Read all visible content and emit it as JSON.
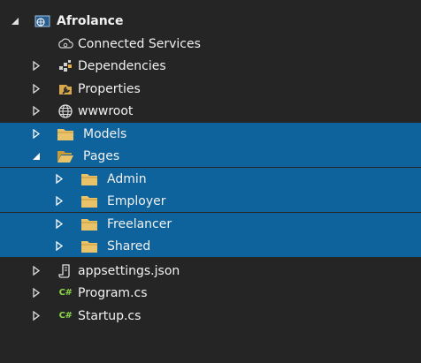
{
  "tree": {
    "project": "Afrolance",
    "items": [
      {
        "label": "Connected Services"
      },
      {
        "label": "Dependencies"
      },
      {
        "label": "Properties"
      },
      {
        "label": "wwwroot"
      },
      {
        "label": "Models"
      },
      {
        "label": "Pages"
      },
      {
        "label": "Admin"
      },
      {
        "label": "Employer"
      },
      {
        "label": "Freelancer"
      },
      {
        "label": "Shared"
      },
      {
        "label": "appsettings.json"
      },
      {
        "label": "Program.cs"
      },
      {
        "label": "Startup.cs"
      }
    ],
    "icons": {
      "cs_text": "C#"
    }
  },
  "colors": {
    "background": "#252526",
    "selection": "#0e639c",
    "folder": "#e8c36a",
    "csharp": "#8bd84a"
  }
}
